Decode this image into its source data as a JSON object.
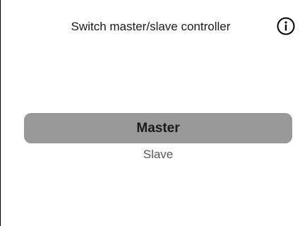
{
  "header": {
    "title": "Switch master/slave controller",
    "info_icon": "info-circle-icon"
  },
  "picker": {
    "options": [
      {
        "label": "Master",
        "selected": true
      },
      {
        "label": "Slave",
        "selected": false
      }
    ]
  },
  "colors": {
    "selected_background": "#999999",
    "text": "#1a1a1a",
    "unselected_text": "#555555"
  }
}
